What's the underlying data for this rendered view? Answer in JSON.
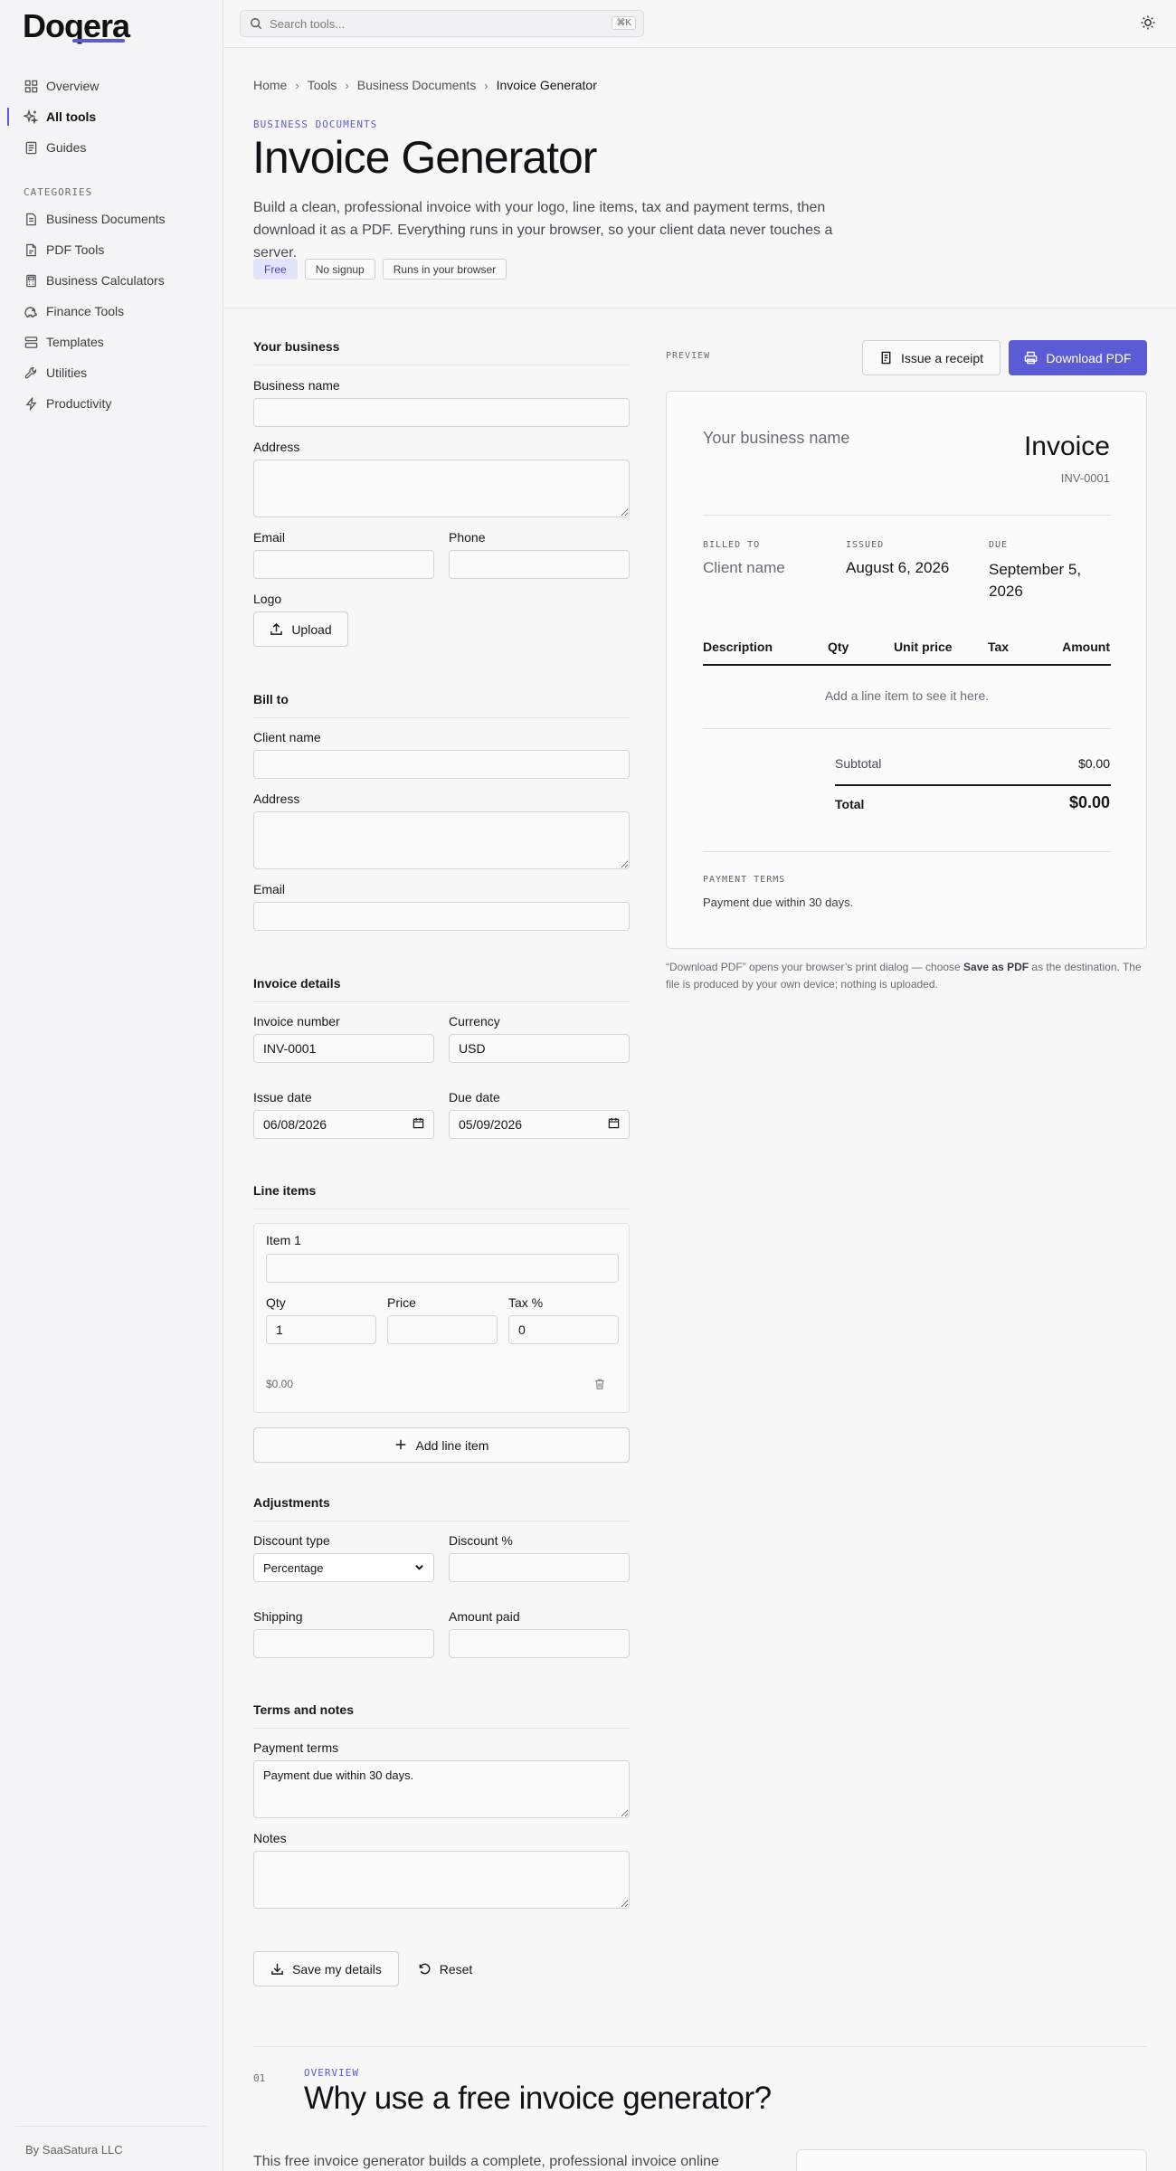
{
  "brand": {
    "logo": "Doqera",
    "accent": "#5b5bd6"
  },
  "topbar": {
    "search_placeholder": "Search tools...",
    "shortcut": "⌘K"
  },
  "sidebar": {
    "main": [
      {
        "label": "Overview",
        "icon": "grid-icon"
      },
      {
        "label": "All tools",
        "icon": "sparkle-icon",
        "active": true
      },
      {
        "label": "Guides",
        "icon": "book-icon"
      }
    ],
    "categories_title": "CATEGORIES",
    "categories": [
      {
        "label": "Business Documents",
        "icon": "document-icon"
      },
      {
        "label": "PDF Tools",
        "icon": "pdf-icon"
      },
      {
        "label": "Business Calculators",
        "icon": "calculator-icon"
      },
      {
        "label": "Finance Tools",
        "icon": "piggy-bank-icon"
      },
      {
        "label": "Templates",
        "icon": "template-icon"
      },
      {
        "label": "Utilities",
        "icon": "wrench-icon"
      },
      {
        "label": "Productivity",
        "icon": "bolt-icon"
      }
    ],
    "footer": "By SaaSatura LLC"
  },
  "breadcrumb": [
    "Home",
    "Tools",
    "Business Documents",
    "Invoice Generator"
  ],
  "header": {
    "eyebrow": "BUSINESS DOCUMENTS",
    "title": "Invoice Generator",
    "lead": "Build a clean, professional invoice with your logo, line items, tax and payment terms, then download it as a PDF. Everything runs in your browser, so your client data never touches a server.",
    "badges": [
      "Free",
      "No signup",
      "Runs in your browser"
    ]
  },
  "form": {
    "business": {
      "title": "Your business",
      "name_label": "Business name",
      "address_label": "Address",
      "email_label": "Email",
      "phone_label": "Phone",
      "logo_label": "Logo",
      "upload_label": "Upload"
    },
    "bill_to": {
      "title": "Bill to",
      "client_label": "Client name",
      "address_label": "Address",
      "email_label": "Email"
    },
    "details": {
      "title": "Invoice details",
      "number_label": "Invoice number",
      "number_value": "INV-0001",
      "currency_label": "Currency",
      "currency_value": "USD",
      "issue_label": "Issue date",
      "issue_value": "06/08/2026",
      "due_label": "Due date",
      "due_value": "05/09/2026"
    },
    "line_items": {
      "title": "Line items",
      "item_label": "Item 1",
      "qty_label": "Qty",
      "qty_value": "1",
      "price_label": "Price",
      "tax_label": "Tax %",
      "tax_value": "0",
      "line_total": "$0.00",
      "add_label": "Add line item"
    },
    "adjustments": {
      "title": "Adjustments",
      "discount_type_label": "Discount type",
      "discount_type_value": "Percentage",
      "discount_label": "Discount %",
      "shipping_label": "Shipping",
      "paid_label": "Amount paid"
    },
    "terms": {
      "title": "Terms and notes",
      "payment_label": "Payment terms",
      "payment_value": "Payment due within 30 days.",
      "notes_label": "Notes"
    },
    "save_label": "Save my details",
    "reset_label": "Reset"
  },
  "preview": {
    "label": "PREVIEW",
    "receipt_label": "Issue a receipt",
    "download_label": "Download PDF",
    "business_placeholder": "Your business name",
    "doc_title": "Invoice",
    "number": "INV-0001",
    "billed_to_cap": "BILLED TO",
    "client_placeholder": "Client name",
    "issued_cap": "ISSUED",
    "issued_value": "August 6, 2026",
    "due_cap": "DUE",
    "due_value_1": "September 5,",
    "due_value_2": "2026",
    "columns": [
      "Description",
      "Qty",
      "Unit price",
      "Tax",
      "Amount"
    ],
    "empty_text": "Add a line item to see it here.",
    "subtotal_label": "Subtotal",
    "subtotal_value": "$0.00",
    "total_label": "Total",
    "total_value": "$0.00",
    "terms_cap": "PAYMENT TERMS",
    "terms_value": "Payment due within 30 days."
  },
  "pdf_note": {
    "part1": "“Download PDF” opens your browser’s print dialog — choose ",
    "bold": "Save as PDF",
    "part2": " as the destination. The file is produced by your own device; nothing is uploaded."
  },
  "overview": {
    "number": "01",
    "eyebrow": "OVERVIEW",
    "title": "Why use a free invoice generator?",
    "text": "This free invoice generator builds a complete, professional invoice online"
  }
}
